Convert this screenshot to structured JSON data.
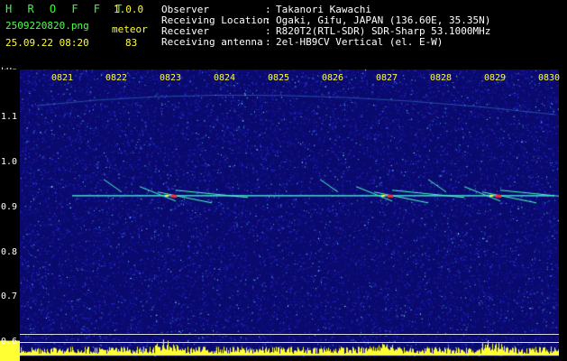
{
  "header": {
    "app_name": "H R O F F T",
    "version": "1.0.0",
    "filename": "2509220820.png",
    "label_meteor": "meteor",
    "datetime": "25.09.22 08:20",
    "meteor_count": "83",
    "fields": [
      {
        "key": "Observer",
        "sep": ":",
        "value": "Takanori Kawachi"
      },
      {
        "key": "Receiving Location",
        "sep": ":",
        "value": "Ogaki, Gifu, JAPAN (136.60E, 35.35N)"
      },
      {
        "key": "Receiver",
        "sep": ":",
        "value": "R820T2(RTL-SDR) SDR-Sharp 53.1000MHz"
      },
      {
        "key": "Receiving antenna",
        "sep": ":",
        "value": "2el-HB9CV Vertical (el. E-W)"
      }
    ]
  },
  "axes": {
    "y_unit": "kHz",
    "y_ticks": [
      "1.1",
      "1.0",
      "0.9",
      "0.8",
      "0.7",
      "0.6"
    ],
    "x_ticks": [
      "0821",
      "0822",
      "0823",
      "0824",
      "0825",
      "0826",
      "0827",
      "0828",
      "0829",
      "0830"
    ]
  },
  "chart_data": {
    "type": "heatmap",
    "ylabel": "kHz",
    "ylim": [
      0.6,
      1.15
    ],
    "x": [
      "0821",
      "0822",
      "0823",
      "0824",
      "0825",
      "0826",
      "0827",
      "0828",
      "0829",
      "0830"
    ],
    "carrier_frequency_khz": 0.905,
    "meteor_echoes": [
      {
        "time": "0823",
        "freq_khz": 0.905
      },
      {
        "time": "0827",
        "freq_khz": 0.905
      },
      {
        "time": "0829",
        "freq_khz": 0.905
      }
    ]
  },
  "colors": {
    "background": "#000000",
    "plot_noise": "#1a1aa0",
    "trace": "#4cffe0",
    "axis_text": "#ffff33",
    "title_text": "#33ff33"
  }
}
